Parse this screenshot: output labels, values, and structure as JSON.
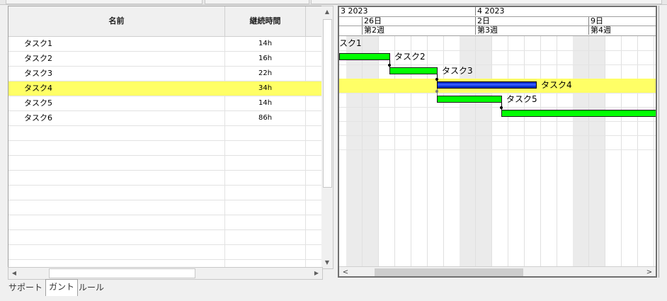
{
  "grid": {
    "headers": {
      "name": "名前",
      "duration": "継続時間"
    },
    "rows": [
      {
        "name": "タスク1",
        "duration": "14h"
      },
      {
        "name": "タスク2",
        "duration": "16h"
      },
      {
        "name": "タスク3",
        "duration": "22h"
      },
      {
        "name": "タスク4",
        "duration": "34h"
      },
      {
        "name": "タスク5",
        "duration": "14h"
      },
      {
        "name": "タスク6",
        "duration": "86h"
      }
    ],
    "selected_row": "タスク4"
  },
  "gantt": {
    "months": [
      "3 2023",
      "4 2023"
    ],
    "days": [
      "26日",
      "2日",
      "9日"
    ],
    "weeks": [
      "第2週",
      "第3週",
      "第4週"
    ],
    "bar_labels": [
      "スク1",
      "タスク2",
      "タスク3",
      "タスク4",
      "タスク5",
      ""
    ],
    "colors": {
      "bar": "#00ff00",
      "critical": "#0033cc",
      "selection": "#ffff66"
    }
  },
  "scroll": {
    "left_arrow": "◀",
    "right_arrow": "▶",
    "up_arrow": "▲",
    "down_arrow": "▼",
    "gantt_left": "<",
    "gantt_right": ">"
  },
  "tabs": [
    "サポート",
    "ガント",
    "ルール"
  ],
  "active_tab": "ガント"
}
